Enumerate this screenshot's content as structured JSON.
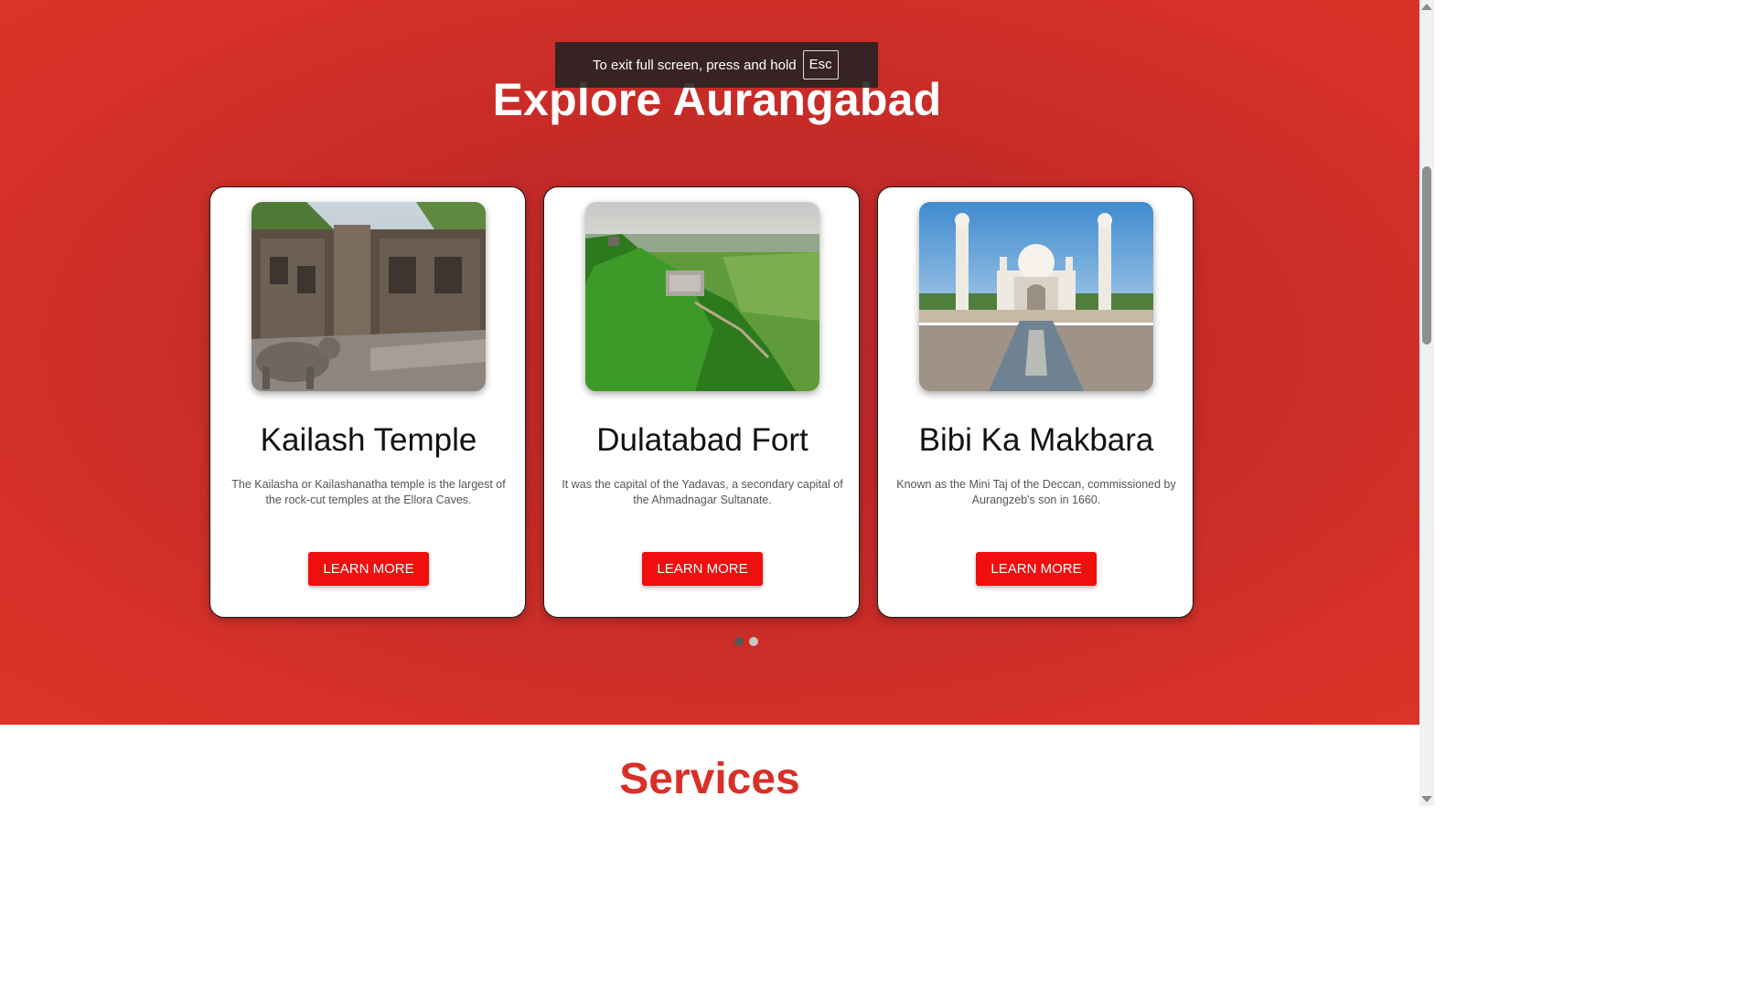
{
  "fullscreen_notice": {
    "text": "To exit full screen, press and hold",
    "key": "Esc"
  },
  "hero": {
    "title": "Explore Aurangabad"
  },
  "cards": [
    {
      "title": "Kailash Temple",
      "description": "The Kailasha or Kailashanatha temple is the largest of the rock-cut temples at the Ellora Caves.",
      "button": "LEARN MORE"
    },
    {
      "title": "Dulatabad Fort",
      "description": "It was the capital of the Yadavas, a secondary capital of the Ahmadnagar Sultanate.",
      "button": "LEARN MORE"
    },
    {
      "title": "Bibi Ka Makbara",
      "description": "Known as the Mini Taj of the Deccan, commissioned by Aurangzeb's son in 1660.",
      "button": "LEARN MORE"
    }
  ],
  "carousel": {
    "active_index": 0,
    "dot_count": 2
  },
  "services": {
    "title": "Services"
  },
  "colors": {
    "hero_bg": "#d63129",
    "accent_button": "#f00e0e",
    "services_title": "#d83028"
  }
}
